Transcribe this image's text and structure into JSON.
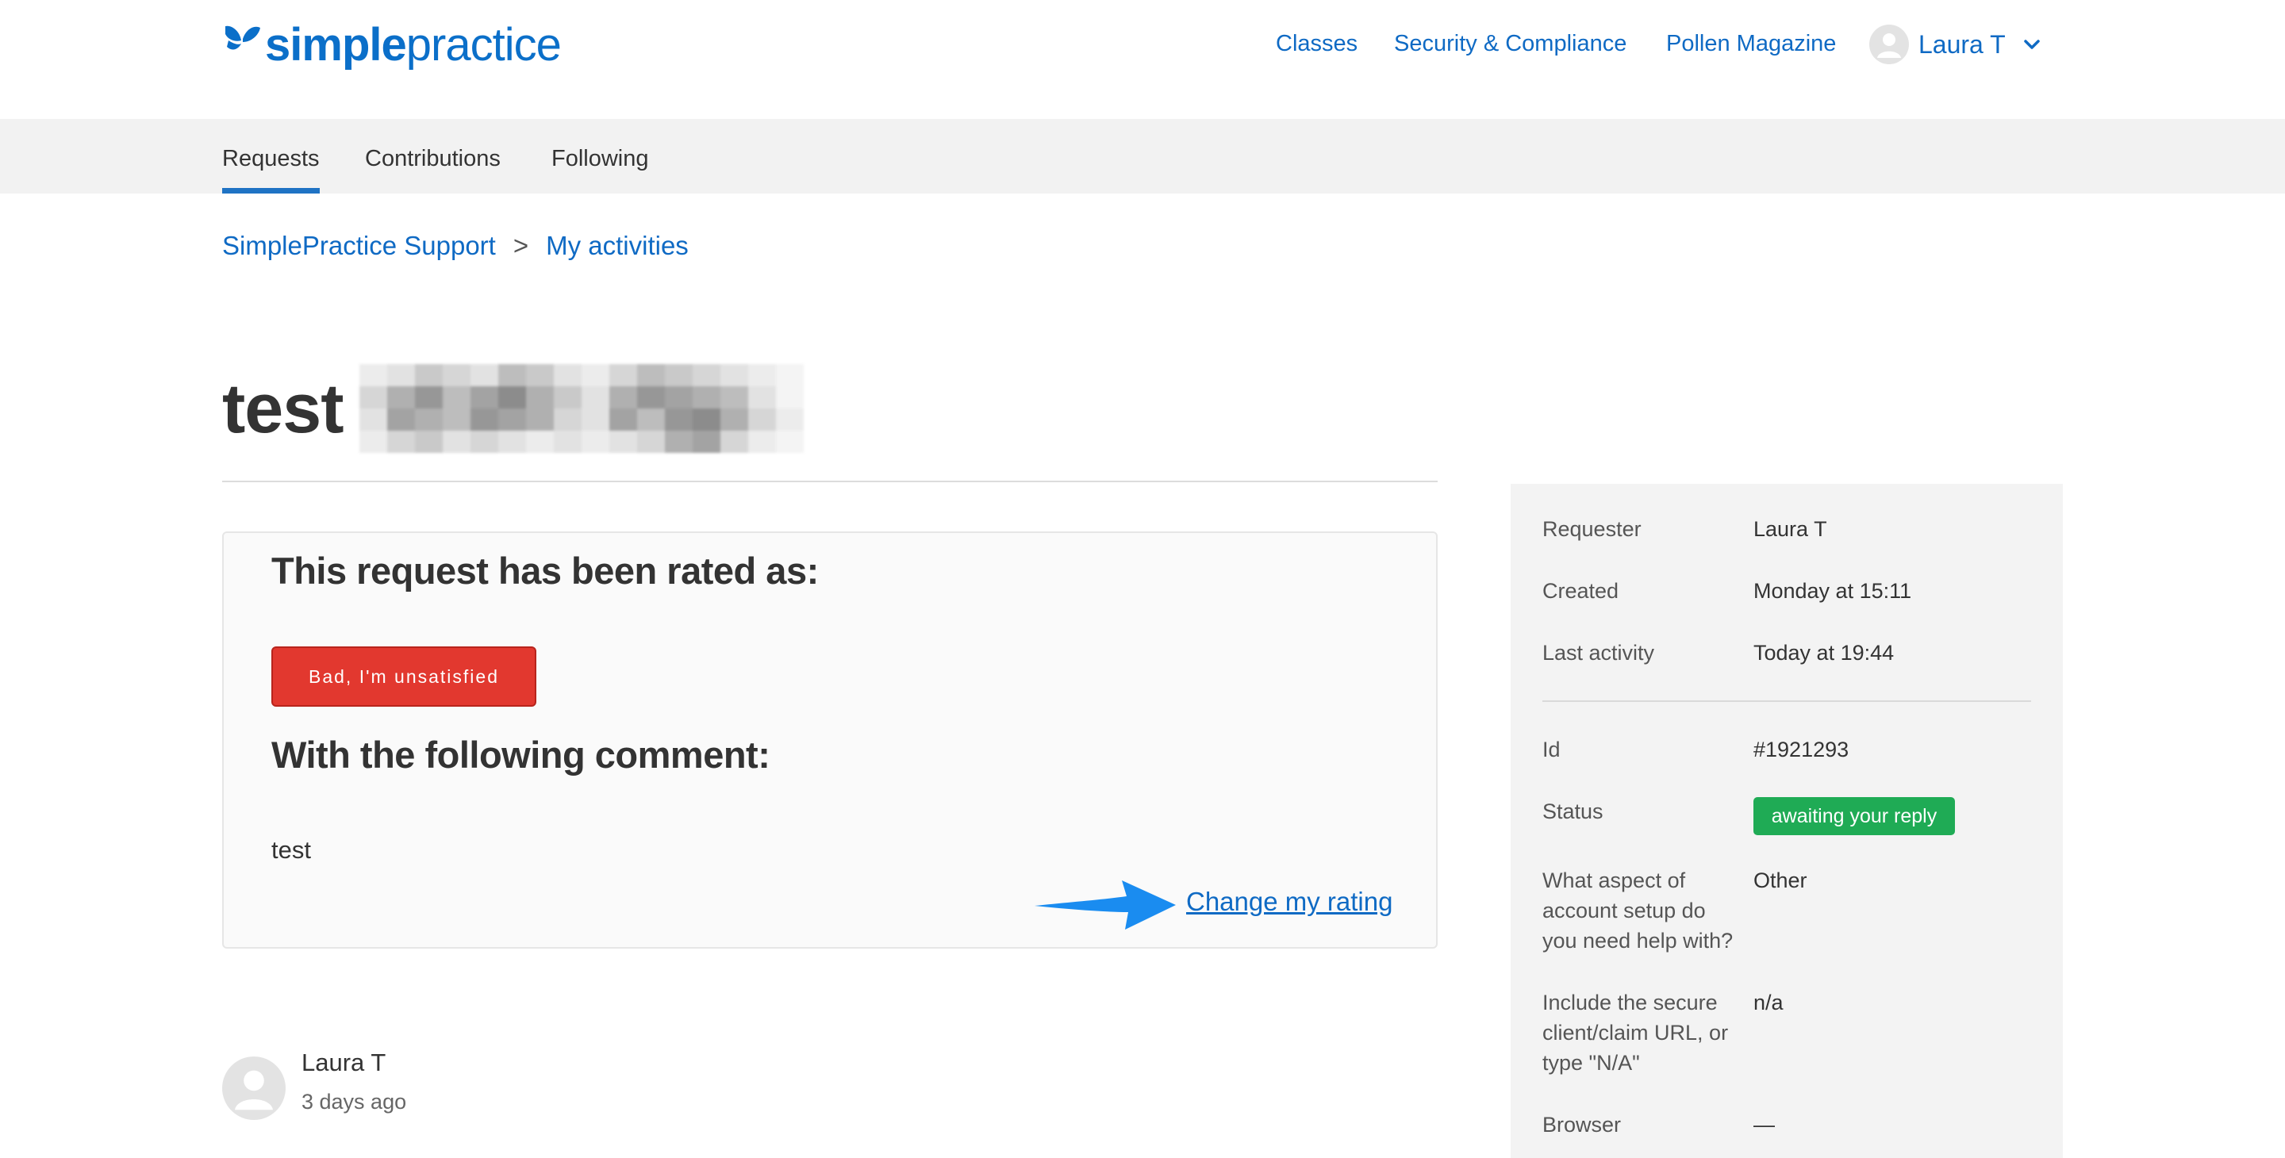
{
  "header": {
    "logo": {
      "simple": "simple",
      "practice": "practice"
    },
    "nav": {
      "classes": "Classes",
      "security": "Security & Compliance",
      "pollen": "Pollen Magazine"
    },
    "user": {
      "name": "Laura T"
    }
  },
  "subnav": {
    "requests": "Requests",
    "contributions": "Contributions",
    "following": "Following"
  },
  "breadcrumb": {
    "root": "SimplePractice Support",
    "separator": ">",
    "current": "My activities"
  },
  "request": {
    "title": "test",
    "rating": {
      "heading": "This request has been rated as:",
      "value": "Bad, I'm unsatisfied",
      "comment_heading": "With the following comment:",
      "comment": "test",
      "change_link": "Change my rating"
    }
  },
  "comment": {
    "author": "Laura T",
    "time": "3 days ago"
  },
  "sidebar": {
    "requester": {
      "label": "Requester",
      "value": "Laura T"
    },
    "created": {
      "label": "Created",
      "value": "Monday at 15:11"
    },
    "last_activity": {
      "label": "Last activity",
      "value": "Today at 19:44"
    },
    "id": {
      "label": "Id",
      "value": "#1921293"
    },
    "status": {
      "label": "Status",
      "value": "awaiting your reply"
    },
    "aspect": {
      "label": "What aspect of account setup do you need help with?",
      "value": "Other"
    },
    "url": {
      "label": "Include the secure client/claim URL, or type \"N/A\"",
      "value": "n/a"
    },
    "browser": {
      "label": "Browser",
      "value": "—"
    }
  },
  "colors": {
    "brand": "#0b6fc9",
    "link": "#0f6ac4",
    "danger": "#e2382f",
    "success": "#1fab55"
  }
}
